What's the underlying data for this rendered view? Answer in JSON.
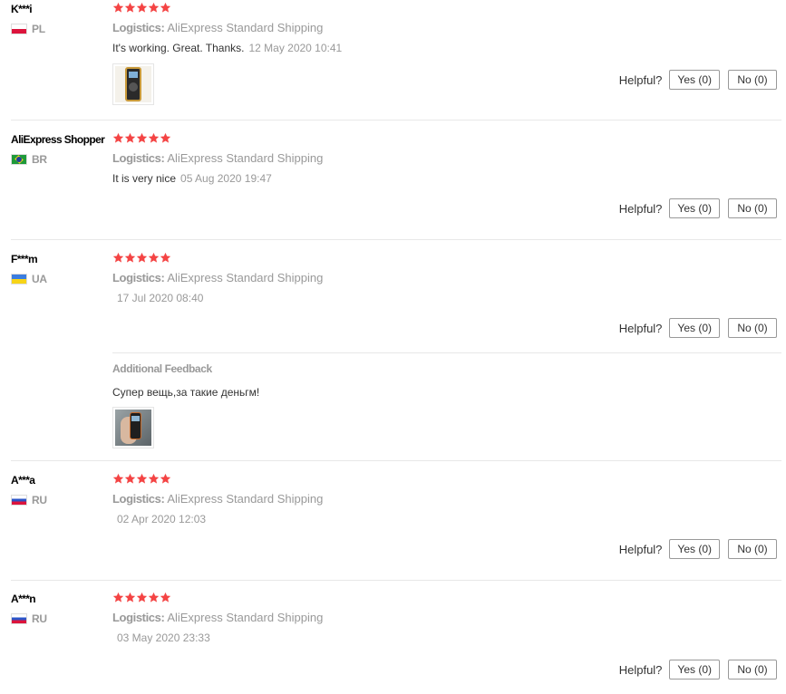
{
  "helpful_label": "Helpful?",
  "logistics_label": "Logistics:",
  "reviews": [
    {
      "name": "K***i",
      "country": "PL",
      "flag": "pl",
      "rating": 5,
      "shipping": "AliExpress Standard Shipping",
      "text": "It's working. Great. Thanks.",
      "date": "12 May 2020 10:41",
      "yes": "Yes (0)",
      "no": "No (0)",
      "has_photo": true,
      "photo_icon": "device-photo"
    },
    {
      "name": "AliExpress Shopper",
      "country": "BR",
      "flag": "br",
      "rating": 5,
      "shipping": "AliExpress Standard Shipping",
      "text": "It is very nice",
      "date": "05 Aug 2020 19:47",
      "yes": "Yes (0)",
      "no": "No (0)",
      "has_photo": false
    },
    {
      "name": "F***m",
      "country": "UA",
      "flag": "ua",
      "rating": 5,
      "shipping": "AliExpress Standard Shipping",
      "text": "",
      "date": "17 Jul 2020 08:40",
      "yes": "Yes (0)",
      "no": "No (0)",
      "has_photo": false,
      "additional": {
        "title": "Additional Feedback",
        "text": "Супер вещь,за такие деньгм!",
        "has_photo": true,
        "photo_icon": "hand-device-photo"
      }
    },
    {
      "name": "A***a",
      "country": "RU",
      "flag": "ru",
      "rating": 5,
      "shipping": "AliExpress Standard Shipping",
      "text": "",
      "date": "02 Apr 2020 12:03",
      "yes": "Yes (0)",
      "no": "No (0)",
      "has_photo": false
    },
    {
      "name": "A***n",
      "country": "RU",
      "flag": "ru",
      "rating": 5,
      "shipping": "AliExpress Standard Shipping",
      "text": "",
      "date": "03 May 2020 23:33",
      "yes": "Yes (0)",
      "no": "No (0)",
      "has_photo": false
    }
  ],
  "colors": {
    "star": "#f44444",
    "muted": "#999999",
    "border": "#e8e8e8"
  }
}
